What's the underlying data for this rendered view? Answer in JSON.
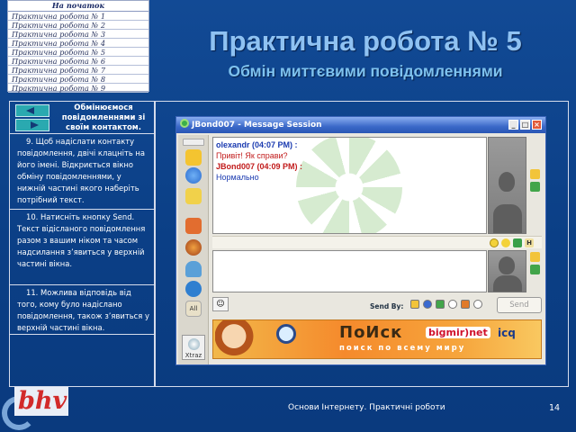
{
  "nav": {
    "home": "На початок",
    "items": [
      "Практична робота № 1",
      "Практична робота № 2",
      "Практична робота № 3",
      "Практична робота № 4",
      "Практична робота № 5",
      "Практична робота № 6",
      "Практична робота № 7",
      "Практична робота № 8",
      "Практична робота № 9"
    ]
  },
  "header": {
    "title": "Практична робота № 5",
    "subtitle": "Обмін миттєвими повідомленнями"
  },
  "steps": {
    "heading": "Обмінюємося повідомленнями зі своїм контактом.",
    "items": [
      "9. Щоб надіслати контакту повідомлення, двічі клацніть на його імені. Відкриється вікно обміну повідомленнями, у нижній частині якого наберіть потрібний текст.",
      "10. Натисніть кнопку Send. Текст відісланого повідомлення разом з вашим ніком та часом надсилання з’явиться у верхній частині вікна.",
      "11. Можлива відповідь від того, кому було надіслано повідомлення, також з’явиться у верхній частині вікна."
    ]
  },
  "window": {
    "title": "JBond007 - Message Session",
    "buttons": {
      "minimize": "_",
      "maximize": "□",
      "close": "×"
    },
    "messages": [
      {
        "sender": "olexandr (04:07 PM) :",
        "text": "Привіт! Як справи?"
      },
      {
        "sender": "JBond007 (04:09 PM) :",
        "text": "Нормально"
      }
    ],
    "tool_all": "All",
    "xtraz": "Xtraz",
    "format_h": "H",
    "send_by": "Send By:",
    "send": "Send",
    "banner": {
      "search": "ПоИск",
      "tagline": "поиск по всему миру",
      "bigmir": "bigmir)net",
      "icq": "icq"
    }
  },
  "footer": {
    "logo": "bhv",
    "text": "Основи Інтернету. Практичні роботи",
    "page": "14"
  },
  "colors": {
    "background": "#124a95",
    "title": "#8fc2f2",
    "nav_button": "#2aa9b0",
    "sender_self": "#c11a1a",
    "sender_other": "#1a3ab0"
  }
}
